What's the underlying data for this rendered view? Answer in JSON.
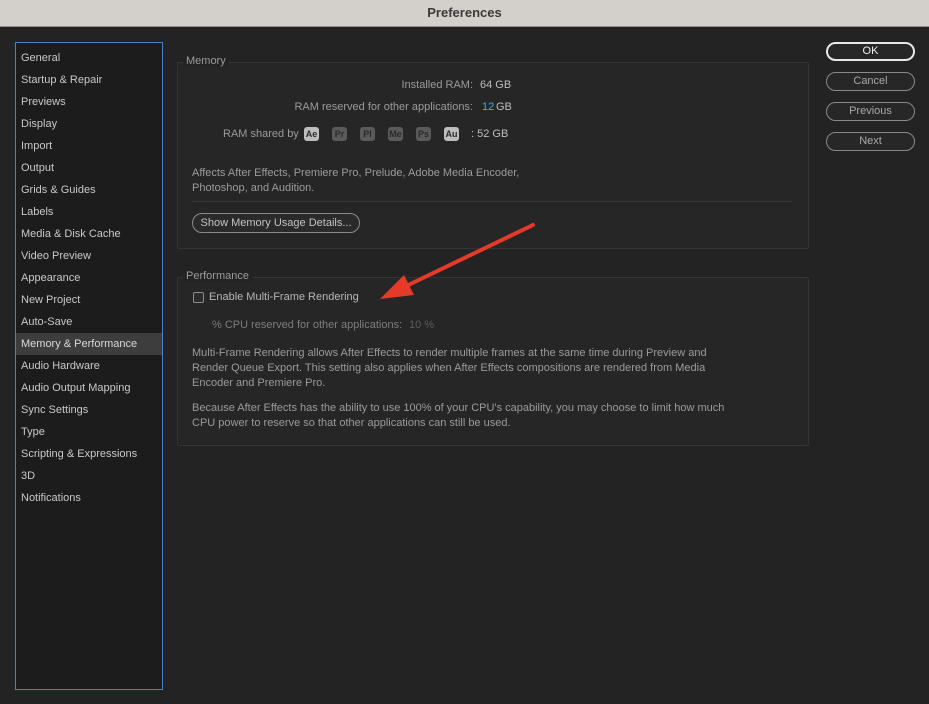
{
  "window": {
    "title": "Preferences"
  },
  "sidebar": {
    "items": [
      {
        "label": "General"
      },
      {
        "label": "Startup & Repair"
      },
      {
        "label": "Previews"
      },
      {
        "label": "Display"
      },
      {
        "label": "Import"
      },
      {
        "label": "Output"
      },
      {
        "label": "Grids & Guides"
      },
      {
        "label": "Labels"
      },
      {
        "label": "Media & Disk Cache"
      },
      {
        "label": "Video Preview"
      },
      {
        "label": "Appearance"
      },
      {
        "label": "New Project"
      },
      {
        "label": "Auto-Save"
      },
      {
        "label": "Memory & Performance",
        "selected": true
      },
      {
        "label": "Audio Hardware"
      },
      {
        "label": "Audio Output Mapping"
      },
      {
        "label": "Sync Settings"
      },
      {
        "label": "Type"
      },
      {
        "label": "Scripting & Expressions"
      },
      {
        "label": "3D"
      },
      {
        "label": "Notifications"
      }
    ]
  },
  "memory": {
    "legend": "Memory",
    "installed_ram_label": "Installed RAM:",
    "installed_ram_value": "64 GB",
    "reserved_label": "RAM reserved for other applications:",
    "reserved_value": "12",
    "reserved_unit": "GB",
    "shared_label": "RAM shared by",
    "apps": [
      {
        "abbr": "Ae",
        "active": true
      },
      {
        "abbr": "Pr",
        "active": false
      },
      {
        "abbr": "Pl",
        "active": false
      },
      {
        "abbr": "Me",
        "active": false
      },
      {
        "abbr": "Ps",
        "active": false
      },
      {
        "abbr": "Au",
        "active": true
      }
    ],
    "shared_value": ": 52 GB",
    "description_line1": "Affects After Effects, Premiere Pro, Prelude, Adobe Media Encoder,",
    "description_line2": "Photoshop, and Audition.",
    "details_button": "Show Memory Usage Details..."
  },
  "performance": {
    "legend": "Performance",
    "mfr_checkbox_label": "Enable Multi-Frame Rendering",
    "mfr_checked": false,
    "cpu_label": "% CPU reserved for other applications:",
    "cpu_value": "10 %",
    "para1_line1": "Multi-Frame Rendering allows After Effects to render multiple frames at the same time during Preview and",
    "para1_line2": "Render Queue Export. This setting also applies when After Effects compositions are rendered from Media",
    "para1_line3": "Encoder and Premiere Pro.",
    "para2_line1": "Because After Effects has the ability to use 100% of your CPU's capability, you may choose to limit how much",
    "para2_line2": "CPU power to reserve so that other applications can still be used."
  },
  "buttons": {
    "ok": "OK",
    "cancel": "Cancel",
    "previous": "Previous",
    "next": "Next"
  },
  "colors": {
    "accent_blue": "#5aa0e8",
    "selection_border": "#4e80c4",
    "annotation_arrow": "#e53a2a"
  },
  "icons": {
    "annotation": "red-arrow-icon"
  }
}
